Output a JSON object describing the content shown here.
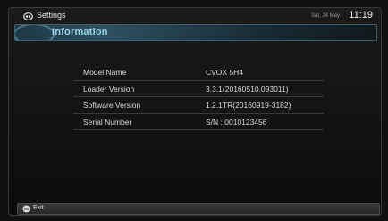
{
  "header": {
    "app_name": "Settings",
    "app_icon": "settings-app-icon",
    "date": "Sat, 24 May",
    "time": "11:19"
  },
  "page": {
    "title": "Information"
  },
  "info": {
    "rows": [
      {
        "label": "Model Name",
        "value": "CVOX 5H4"
      },
      {
        "label": "Loader Version",
        "value": "3.3.1(20160510.093011)"
      },
      {
        "label": "Software Version",
        "value": "1.2.1TR(20160919-3182)"
      },
      {
        "label": "Serial Number",
        "value": "S/N : 0010123456"
      }
    ]
  },
  "footer": {
    "exit_label": "Exit",
    "exit_icon": "remote-button-icon"
  },
  "colors": {
    "accent": "#9ad4e6",
    "background": "#101010"
  }
}
